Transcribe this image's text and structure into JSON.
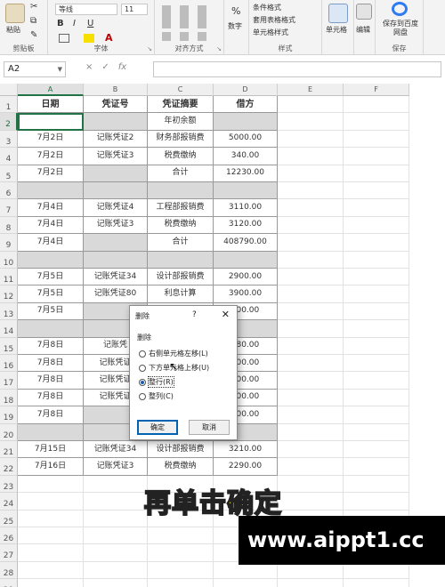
{
  "ribbon": {
    "paste_label": "粘贴",
    "clipboard_label": "剪贴板",
    "font_name": "等线",
    "font_size": "11",
    "font_group_label": "字体",
    "align_group_label": "对齐方式",
    "number_label": "数字",
    "cond_format_label": "条件格式",
    "table_format_label": "套用表格格式",
    "cell_style_label": "单元格样式",
    "style_group_label": "样式",
    "cells_label": "单元格",
    "edit_label": "编辑",
    "save_baidu_label": "保存到百度网盘",
    "save_group_label": "保存",
    "bold": "B",
    "italic": "I",
    "underline": "U",
    "percent": "%"
  },
  "formula_bar": {
    "name_box": "A2",
    "cancel": "×",
    "enter": "✓",
    "fx": "fx",
    "formula": ""
  },
  "columns": [
    "A",
    "B",
    "C",
    "D",
    "E",
    "F"
  ],
  "rows": [
    {
      "n": "1",
      "a": "日期",
      "b": "凭证号",
      "c": "凭证摘要",
      "d": "借方",
      "gray": false,
      "header": true
    },
    {
      "n": "2",
      "a": "",
      "b": "",
      "c": "年初余额",
      "d": "",
      "gray": false,
      "bgray": true,
      "dgray": true
    },
    {
      "n": "3",
      "a": "7月2日",
      "b": "记账凭证2",
      "c": "财务部报销费",
      "d": "5000.00",
      "gray": false
    },
    {
      "n": "4",
      "a": "7月2日",
      "b": "记账凭证3",
      "c": "税费缴纳",
      "d": "340.00",
      "gray": false
    },
    {
      "n": "5",
      "a": "7月2日",
      "b": "",
      "c": "合计",
      "d": "12230.00",
      "gray": false,
      "bgray": true
    },
    {
      "n": "6",
      "a": "",
      "b": "",
      "c": "",
      "d": "",
      "gray": true
    },
    {
      "n": "7",
      "a": "7月4日",
      "b": "记账凭证4",
      "c": "工程部报销费",
      "d": "3110.00",
      "gray": false
    },
    {
      "n": "8",
      "a": "7月4日",
      "b": "记账凭证3",
      "c": "税费缴纳",
      "d": "3120.00",
      "gray": false
    },
    {
      "n": "9",
      "a": "7月4日",
      "b": "",
      "c": "合计",
      "d": "408790.00",
      "gray": false,
      "bgray": true
    },
    {
      "n": "10",
      "a": "",
      "b": "",
      "c": "",
      "d": "",
      "gray": true
    },
    {
      "n": "11",
      "a": "7月5日",
      "b": "记账凭证34",
      "c": "设计部报销费",
      "d": "2900.00",
      "gray": false
    },
    {
      "n": "12",
      "a": "7月5日",
      "b": "记账凭证80",
      "c": "利息计算",
      "d": "3900.00",
      "gray": false
    },
    {
      "n": "13",
      "a": "7月5日",
      "b": "",
      "c": "",
      "d": "000.00",
      "gray": false,
      "bgray": true
    },
    {
      "n": "14",
      "a": "",
      "b": "",
      "c": "",
      "d": "",
      "gray": true
    },
    {
      "n": "15",
      "a": "7月8日",
      "b": "记账凭",
      "c": "",
      "d": "380.00",
      "gray": false
    },
    {
      "n": "16",
      "a": "7月8日",
      "b": "记账凭证",
      "c": "",
      "d": "300.00",
      "gray": false
    },
    {
      "n": "17",
      "a": "7月8日",
      "b": "记账凭证",
      "c": "",
      "d": "300.00",
      "gray": false
    },
    {
      "n": "18",
      "a": "7月8日",
      "b": "记账凭证",
      "c": "",
      "d": "300.00",
      "gray": false
    },
    {
      "n": "19",
      "a": "7月8日",
      "b": "",
      "c": "",
      "d": "900.00",
      "gray": false,
      "bgray": true
    },
    {
      "n": "20",
      "a": "",
      "b": "",
      "c": "",
      "d": "",
      "gray": true
    },
    {
      "n": "21",
      "a": "7月15日",
      "b": "记账凭证34",
      "c": "设计部报销费",
      "d": "3210.00",
      "gray": false
    },
    {
      "n": "22",
      "a": "7月16日",
      "b": "记账凭证3",
      "c": "税费缴纳",
      "d": "2290.00",
      "gray": false
    },
    {
      "n": "23",
      "a": "",
      "b": "",
      "c": "",
      "d": ""
    },
    {
      "n": "24",
      "a": "",
      "b": "",
      "c": "",
      "d": ""
    },
    {
      "n": "25",
      "a": "",
      "b": "",
      "c": "",
      "d": ""
    },
    {
      "n": "26",
      "a": "",
      "b": "",
      "c": "",
      "d": ""
    },
    {
      "n": "27",
      "a": "",
      "b": "",
      "c": "",
      "d": ""
    },
    {
      "n": "28",
      "a": "",
      "b": "",
      "c": "",
      "d": ""
    },
    {
      "n": "29",
      "a": "",
      "b": "",
      "c": "",
      "d": ""
    }
  ],
  "dialog": {
    "title": "删除",
    "help": "?",
    "close": "✕",
    "group": "删除",
    "options": [
      {
        "label": "右侧单元格左移(L)",
        "selected": false
      },
      {
        "label": "下方单元格上移(U)",
        "selected": false
      },
      {
        "label": "整行(R)",
        "selected": true
      },
      {
        "label": "整列(C)",
        "selected": false
      }
    ],
    "ok": "确定",
    "cancel": "取消"
  },
  "subtitle": "再单击确定",
  "watermark": "www.aippt1.cc",
  "colors": {
    "excel_green": "#217346",
    "gray_fill": "#d9d9d9",
    "subtitle_fill": "#f6e31c"
  }
}
